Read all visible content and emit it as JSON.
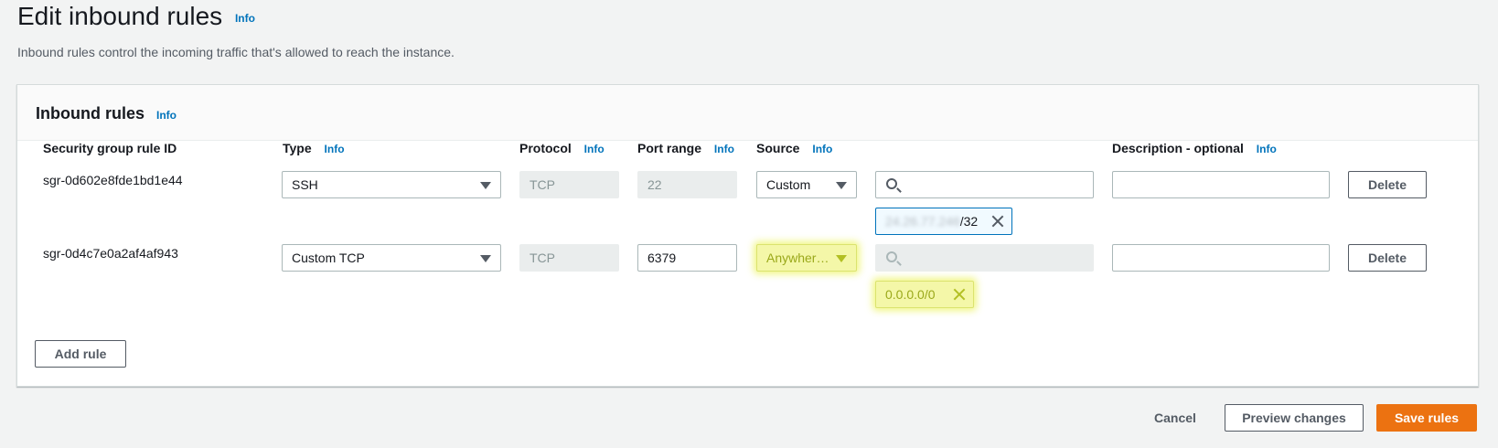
{
  "page": {
    "title": "Edit inbound rules",
    "title_info": "Info",
    "description": "Inbound rules control the incoming traffic that's allowed to reach the instance."
  },
  "panel": {
    "title": "Inbound rules",
    "title_info": "Info",
    "columns": {
      "rule_id": "Security group rule ID",
      "type": "Type",
      "type_info": "Info",
      "protocol": "Protocol",
      "protocol_info": "Info",
      "port_range": "Port range",
      "port_info": "Info",
      "source": "Source",
      "source_info": "Info",
      "description": "Description - optional",
      "description_info": "Info"
    },
    "rows": [
      {
        "rule_id": "sgr-0d602e8fde1bd1e44",
        "type": "SSH",
        "protocol": "TCP",
        "port_range": "22",
        "source": "Custom",
        "cidr_token_blurred": "24.26.77.246",
        "cidr_token_suffix": "/32",
        "description": "",
        "delete_label": "Delete"
      },
      {
        "rule_id": "sgr-0d4c7e0a2af4af943",
        "type": "Custom TCP",
        "protocol": "TCP",
        "port_range": "6379",
        "source": "Anywher…",
        "cidr_token": "0.0.0.0/0",
        "description": "",
        "delete_label": "Delete"
      }
    ],
    "add_rule_label": "Add rule"
  },
  "footer": {
    "cancel_label": "Cancel",
    "preview_label": "Preview changes",
    "save_label": "Save rules"
  },
  "colors": {
    "primary": "#ec7211",
    "link": "#0073bb",
    "highlight": "#f4f7a8"
  }
}
